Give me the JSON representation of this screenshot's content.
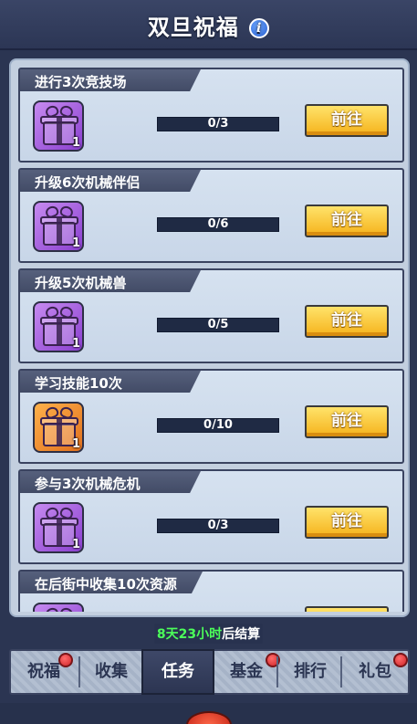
{
  "header": {
    "title": "双旦祝福",
    "info_icon": "info-icon"
  },
  "tasks": [
    {
      "label": "进行3次竞技场",
      "gift_color": "purple",
      "reward_qty": "1",
      "progress_text": "0/3",
      "progress": 0,
      "button": "前往"
    },
    {
      "label": "升级6次机械伴侣",
      "gift_color": "purple",
      "reward_qty": "1",
      "progress_text": "0/6",
      "progress": 0,
      "button": "前往"
    },
    {
      "label": "升级5次机械兽",
      "gift_color": "purple",
      "reward_qty": "1",
      "progress_text": "0/5",
      "progress": 0,
      "button": "前往"
    },
    {
      "label": "学习技能10次",
      "gift_color": "orange",
      "reward_qty": "1",
      "progress_text": "0/10",
      "progress": 0,
      "button": "前往"
    },
    {
      "label": "参与3次机械危机",
      "gift_color": "purple",
      "reward_qty": "1",
      "progress_text": "0/3",
      "progress": 0,
      "button": "前往"
    },
    {
      "label": "在后街中收集10次资源",
      "gift_color": "purple",
      "reward_qty": "",
      "progress_text": "",
      "progress": 0,
      "button": ""
    }
  ],
  "timer": {
    "highlight": "8天23小时",
    "suffix": "后结算"
  },
  "tabs": [
    {
      "label": "祝福",
      "active": false,
      "red_dot": true
    },
    {
      "label": "收集",
      "active": false,
      "red_dot": false
    },
    {
      "label": "任务",
      "active": true,
      "red_dot": false
    },
    {
      "label": "基金",
      "active": false,
      "red_dot": true
    },
    {
      "label": "排行",
      "active": false,
      "red_dot": false
    },
    {
      "label": "礼包",
      "active": false,
      "red_dot": true
    }
  ],
  "colors": {
    "accent_green": "#4cff5a",
    "button_yellow": "#f5b21b",
    "red_dot": "#d0262a"
  }
}
